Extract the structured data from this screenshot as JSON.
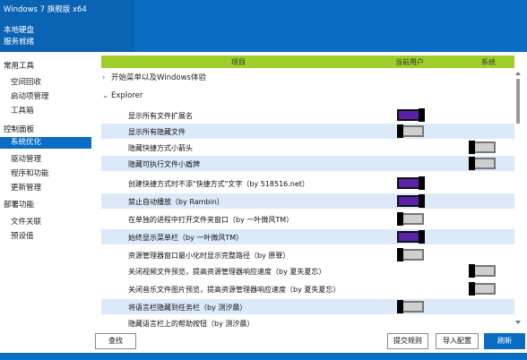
{
  "header": {
    "title": "Windows 7 旗舰版 x64",
    "line2": "本地硬盘",
    "line3": "服务就绪"
  },
  "sidebar": {
    "cat1": "常用工具",
    "items1": [
      "空间回收",
      "启动项管理",
      "工具箱"
    ],
    "cat2": "控制面板",
    "items2": [
      "系统优化",
      "驱动管理",
      "程序和功能",
      "更新管理"
    ],
    "cat3": "部署功能",
    "items3": [
      "文件关联",
      "预设值"
    ]
  },
  "table": {
    "col_item": "项目",
    "col_user": "当前用户",
    "col_system": "系统"
  },
  "groups": {
    "start_menu": "开始菜单以及Windows体验",
    "explorer": "Explorer"
  },
  "rows": [
    {
      "label": "显示所有文件扩展名",
      "user": "on",
      "system": null
    },
    {
      "label": "显示所有隐藏文件",
      "user": "off",
      "system": null
    },
    {
      "label": "隐藏快捷方式小箭头",
      "user": null,
      "system": "off"
    },
    {
      "label": "隐藏可执行文件小盾牌",
      "user": null,
      "system": "off"
    },
    {
      "label": "创建快捷方式时不添\"快捷方式\"文字（by 518516.net）",
      "user": "on",
      "system": null
    },
    {
      "label": "禁止自动播放（by Rambin）",
      "user": "on",
      "system": null
    },
    {
      "label": "在单独的进程中打开文件夹窗口（by 一叶微风TM）",
      "user": "off",
      "system": null
    },
    {
      "label": "始终显示菜单栏（by 一叶微风TM）",
      "user": "on",
      "system": null
    },
    {
      "label": "资源管理器窗口最小化时显示完整路径（by 原罪）",
      "user": "off",
      "system": null
    },
    {
      "label": "关闭视频文件预览，提高资源管理器响应速度（by 夏失夏忘）",
      "user": null,
      "system": "off"
    },
    {
      "label": "关闭音乐文件图片预览，提高资源管理器响应速度（by 夏失夏忘）",
      "user": null,
      "system": "off"
    },
    {
      "label": "将语言栏隐藏到任务栏（by 测汐晨）",
      "user": "off",
      "system": null
    },
    {
      "label": "隐藏语言栏上的帮助按钮（by 测汐晨）",
      "user": "off",
      "system": null
    }
  ],
  "buttons": {
    "search": "查找",
    "submit_rule": "提交规则",
    "import_config": "导入配置",
    "refresh": "刷新"
  },
  "colors": {
    "accent": "#0a6cc2",
    "header_green": "#9fce2a",
    "toggle_on": "#5a22a8",
    "row_alt": "#dbe9f8"
  }
}
